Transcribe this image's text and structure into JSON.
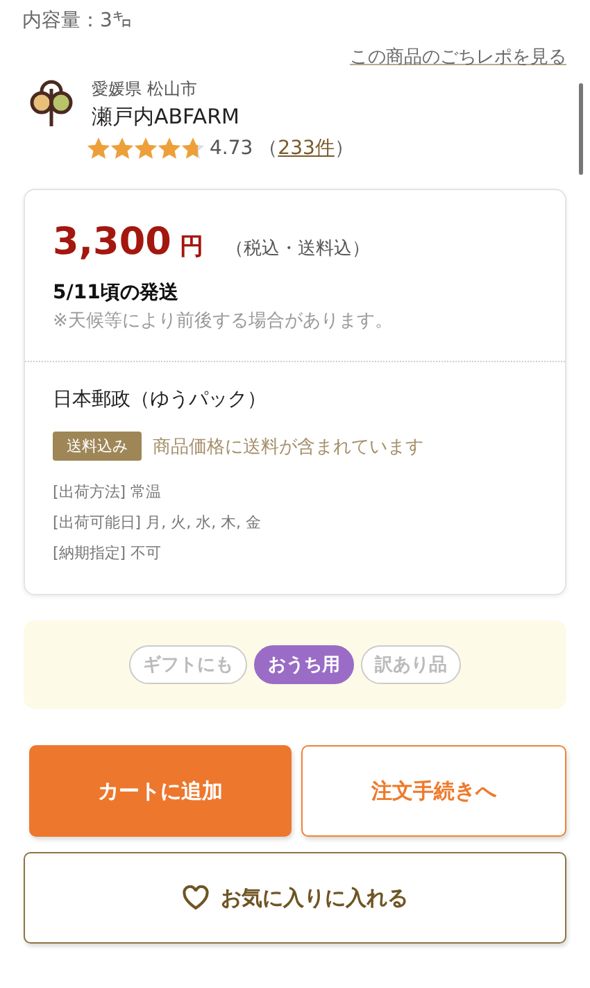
{
  "content_amount": "内容量：3㌔",
  "review_link": "この商品のごちレポを見る",
  "producer": {
    "region": "愛媛県 松山市",
    "name": "瀬戸内ABFARM",
    "stars": 4.73,
    "rating": "4.73",
    "review_prefix": "（",
    "review_count": "233件",
    "review_suffix": "）"
  },
  "price_card": {
    "price": "3,300",
    "currency": "円",
    "tax_note": "（税込・送料込）",
    "ship_date": "5/11頃の発送",
    "ship_note": "※天候等により前後する場合があります。",
    "carrier": "日本郵政（ゆうパック）",
    "badge": "送料込み",
    "badge_note": "商品価格に送料が含まれています",
    "details": [
      "[出荷方法] 常温",
      "[出荷可能日] 月, 火, 水, 木, 金",
      "[納期指定] 不可"
    ]
  },
  "tags": [
    {
      "label": "ギフトにも",
      "selected": false
    },
    {
      "label": "おうち用",
      "selected": true
    },
    {
      "label": "訳あり品",
      "selected": false
    }
  ],
  "buttons": {
    "add_to_cart": "カートに追加",
    "checkout": "注文手続きへ",
    "favorite": "お気に入りに入れる"
  }
}
